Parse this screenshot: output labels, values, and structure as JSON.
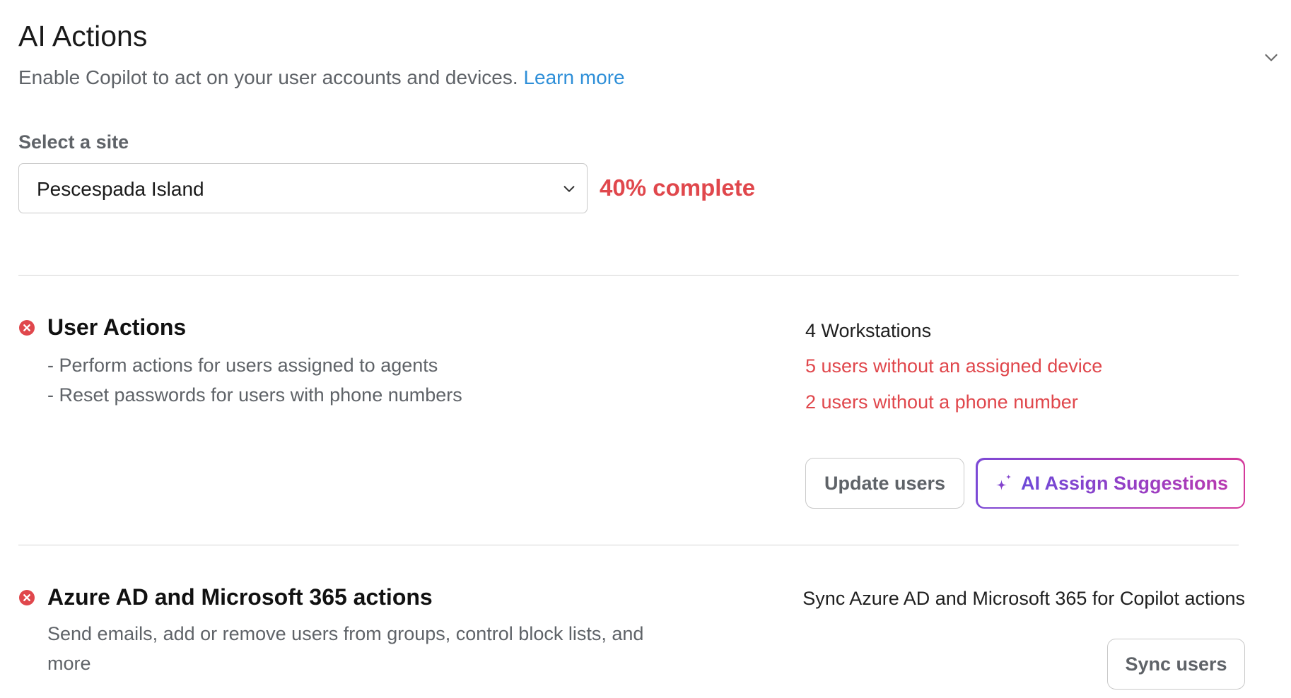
{
  "header": {
    "title": "AI Actions",
    "subtitle": "Enable Copilot to act on your user accounts and devices.",
    "learn_more": "Learn more"
  },
  "site": {
    "label": "Select a site",
    "selected": "Pescespada Island",
    "progress_text": "40% complete",
    "progress_value": 40
  },
  "user_actions": {
    "title": "User Actions",
    "status": "error",
    "items": [
      "- Perform actions for users assigned to agents",
      "- Reset passwords for users with phone numbers"
    ],
    "stats": {
      "workstations": "4 Workstations",
      "no_device": "5 users without an assigned device",
      "no_phone": "2 users without a phone number"
    },
    "update_button": "Update users",
    "ai_button": "AI Assign Suggestions"
  },
  "azure_actions": {
    "title": "Azure AD and Microsoft 365 actions",
    "status": "error",
    "description": "Send emails, add or remove users from groups, control block lists, and more",
    "sync_info": "Sync Azure AD and Microsoft 365 for Copilot actions",
    "sync_button": "Sync users"
  },
  "icons": {
    "status": "error-circle-icon",
    "collapse": "chevron-down-icon",
    "select": "chevron-down-icon",
    "ai": "sparkle-icon"
  },
  "colors": {
    "error": "#e0474c",
    "link": "#2e8fd8",
    "ai_gradient_start": "#7c4ad6",
    "ai_gradient_end": "#d43a9b"
  }
}
